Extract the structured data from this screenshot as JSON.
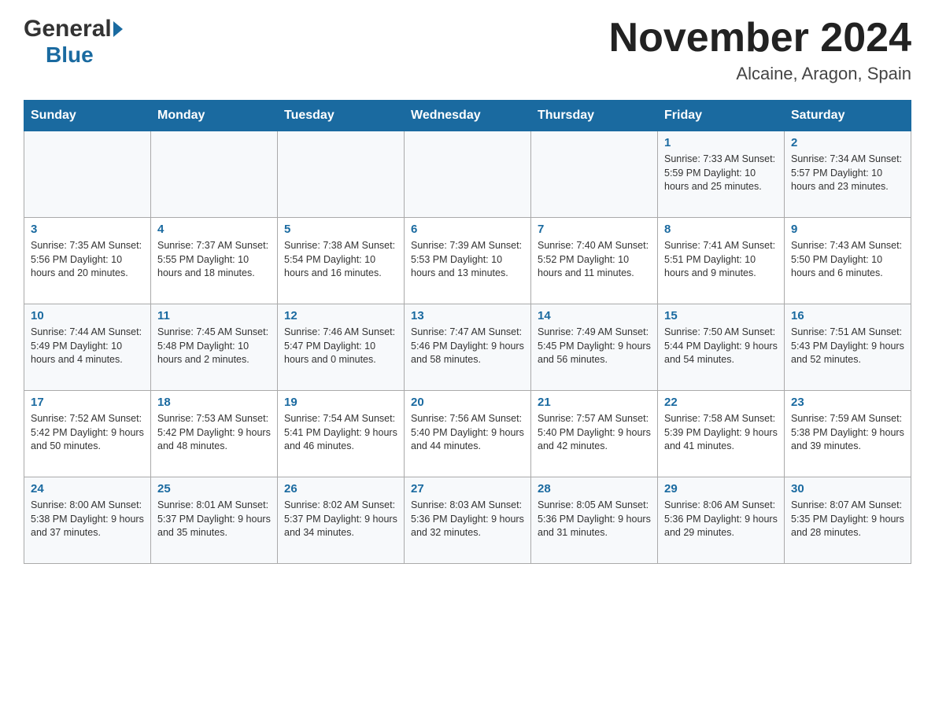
{
  "logo": {
    "general": "General",
    "blue": "Blue"
  },
  "title": {
    "month_year": "November 2024",
    "location": "Alcaine, Aragon, Spain"
  },
  "weekdays": [
    "Sunday",
    "Monday",
    "Tuesday",
    "Wednesday",
    "Thursday",
    "Friday",
    "Saturday"
  ],
  "weeks": [
    [
      {
        "day": "",
        "info": ""
      },
      {
        "day": "",
        "info": ""
      },
      {
        "day": "",
        "info": ""
      },
      {
        "day": "",
        "info": ""
      },
      {
        "day": "",
        "info": ""
      },
      {
        "day": "1",
        "info": "Sunrise: 7:33 AM\nSunset: 5:59 PM\nDaylight: 10 hours and 25 minutes."
      },
      {
        "day": "2",
        "info": "Sunrise: 7:34 AM\nSunset: 5:57 PM\nDaylight: 10 hours and 23 minutes."
      }
    ],
    [
      {
        "day": "3",
        "info": "Sunrise: 7:35 AM\nSunset: 5:56 PM\nDaylight: 10 hours and 20 minutes."
      },
      {
        "day": "4",
        "info": "Sunrise: 7:37 AM\nSunset: 5:55 PM\nDaylight: 10 hours and 18 minutes."
      },
      {
        "day": "5",
        "info": "Sunrise: 7:38 AM\nSunset: 5:54 PM\nDaylight: 10 hours and 16 minutes."
      },
      {
        "day": "6",
        "info": "Sunrise: 7:39 AM\nSunset: 5:53 PM\nDaylight: 10 hours and 13 minutes."
      },
      {
        "day": "7",
        "info": "Sunrise: 7:40 AM\nSunset: 5:52 PM\nDaylight: 10 hours and 11 minutes."
      },
      {
        "day": "8",
        "info": "Sunrise: 7:41 AM\nSunset: 5:51 PM\nDaylight: 10 hours and 9 minutes."
      },
      {
        "day": "9",
        "info": "Sunrise: 7:43 AM\nSunset: 5:50 PM\nDaylight: 10 hours and 6 minutes."
      }
    ],
    [
      {
        "day": "10",
        "info": "Sunrise: 7:44 AM\nSunset: 5:49 PM\nDaylight: 10 hours and 4 minutes."
      },
      {
        "day": "11",
        "info": "Sunrise: 7:45 AM\nSunset: 5:48 PM\nDaylight: 10 hours and 2 minutes."
      },
      {
        "day": "12",
        "info": "Sunrise: 7:46 AM\nSunset: 5:47 PM\nDaylight: 10 hours and 0 minutes."
      },
      {
        "day": "13",
        "info": "Sunrise: 7:47 AM\nSunset: 5:46 PM\nDaylight: 9 hours and 58 minutes."
      },
      {
        "day": "14",
        "info": "Sunrise: 7:49 AM\nSunset: 5:45 PM\nDaylight: 9 hours and 56 minutes."
      },
      {
        "day": "15",
        "info": "Sunrise: 7:50 AM\nSunset: 5:44 PM\nDaylight: 9 hours and 54 minutes."
      },
      {
        "day": "16",
        "info": "Sunrise: 7:51 AM\nSunset: 5:43 PM\nDaylight: 9 hours and 52 minutes."
      }
    ],
    [
      {
        "day": "17",
        "info": "Sunrise: 7:52 AM\nSunset: 5:42 PM\nDaylight: 9 hours and 50 minutes."
      },
      {
        "day": "18",
        "info": "Sunrise: 7:53 AM\nSunset: 5:42 PM\nDaylight: 9 hours and 48 minutes."
      },
      {
        "day": "19",
        "info": "Sunrise: 7:54 AM\nSunset: 5:41 PM\nDaylight: 9 hours and 46 minutes."
      },
      {
        "day": "20",
        "info": "Sunrise: 7:56 AM\nSunset: 5:40 PM\nDaylight: 9 hours and 44 minutes."
      },
      {
        "day": "21",
        "info": "Sunrise: 7:57 AM\nSunset: 5:40 PM\nDaylight: 9 hours and 42 minutes."
      },
      {
        "day": "22",
        "info": "Sunrise: 7:58 AM\nSunset: 5:39 PM\nDaylight: 9 hours and 41 minutes."
      },
      {
        "day": "23",
        "info": "Sunrise: 7:59 AM\nSunset: 5:38 PM\nDaylight: 9 hours and 39 minutes."
      }
    ],
    [
      {
        "day": "24",
        "info": "Sunrise: 8:00 AM\nSunset: 5:38 PM\nDaylight: 9 hours and 37 minutes."
      },
      {
        "day": "25",
        "info": "Sunrise: 8:01 AM\nSunset: 5:37 PM\nDaylight: 9 hours and 35 minutes."
      },
      {
        "day": "26",
        "info": "Sunrise: 8:02 AM\nSunset: 5:37 PM\nDaylight: 9 hours and 34 minutes."
      },
      {
        "day": "27",
        "info": "Sunrise: 8:03 AM\nSunset: 5:36 PM\nDaylight: 9 hours and 32 minutes."
      },
      {
        "day": "28",
        "info": "Sunrise: 8:05 AM\nSunset: 5:36 PM\nDaylight: 9 hours and 31 minutes."
      },
      {
        "day": "29",
        "info": "Sunrise: 8:06 AM\nSunset: 5:36 PM\nDaylight: 9 hours and 29 minutes."
      },
      {
        "day": "30",
        "info": "Sunrise: 8:07 AM\nSunset: 5:35 PM\nDaylight: 9 hours and 28 minutes."
      }
    ]
  ]
}
